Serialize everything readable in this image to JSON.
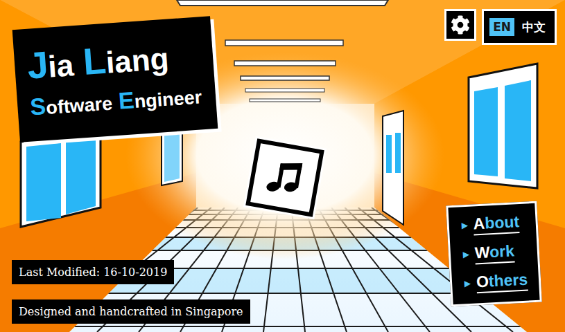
{
  "title_card": {
    "name": [
      {
        "initial": "J",
        "rest": "ia"
      },
      {
        "initial": "L",
        "rest": "iang"
      }
    ],
    "role": [
      {
        "initial": "S",
        "rest": "oftware"
      },
      {
        "initial": "E",
        "rest": "ngineer"
      }
    ]
  },
  "language_toggle": [
    {
      "label": "EN",
      "selected": true
    },
    {
      "label": "中文",
      "selected": false
    }
  ],
  "menu": {
    "marker": "▶",
    "items": [
      {
        "initial": "A",
        "rest": "bout"
      },
      {
        "initial": "W",
        "rest": "ork"
      },
      {
        "initial": "O",
        "rest": "thers"
      }
    ]
  },
  "footer": [
    "Last Modified: 16-10-2019",
    "Designed and handcrafted in Singapore"
  ]
}
